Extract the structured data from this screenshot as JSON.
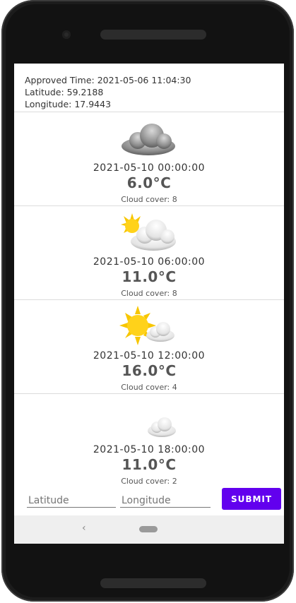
{
  "info": {
    "approved_time": "Approved Time: 2021-05-06 11:04:30",
    "latitude": "Latitude: 59.2188",
    "longitude": "Longitude: 17.9443"
  },
  "forecasts": [
    {
      "time": "2021-05-10 00:00:00",
      "temp": "6.0°C",
      "cover": "Cloud cover: 8",
      "icon": "cloud-icon"
    },
    {
      "time": "2021-05-10 06:00:00",
      "temp": "11.0°C",
      "cover": "Cloud cover: 8",
      "icon": "sun-behind-cloud-icon"
    },
    {
      "time": "2021-05-10 12:00:00",
      "temp": "16.0°C",
      "cover": "Cloud cover: 4",
      "icon": "sun-small-cloud-icon"
    },
    {
      "time": "2021-05-10 18:00:00",
      "temp": "11.0°C",
      "cover": "Cloud cover: 2",
      "icon": "moon-cloud-icon"
    }
  ],
  "form": {
    "latitude_placeholder": "Latitude",
    "longitude_placeholder": "Longitude",
    "submit_label": "SUBMIT"
  },
  "colors": {
    "accent": "#6200ee"
  }
}
